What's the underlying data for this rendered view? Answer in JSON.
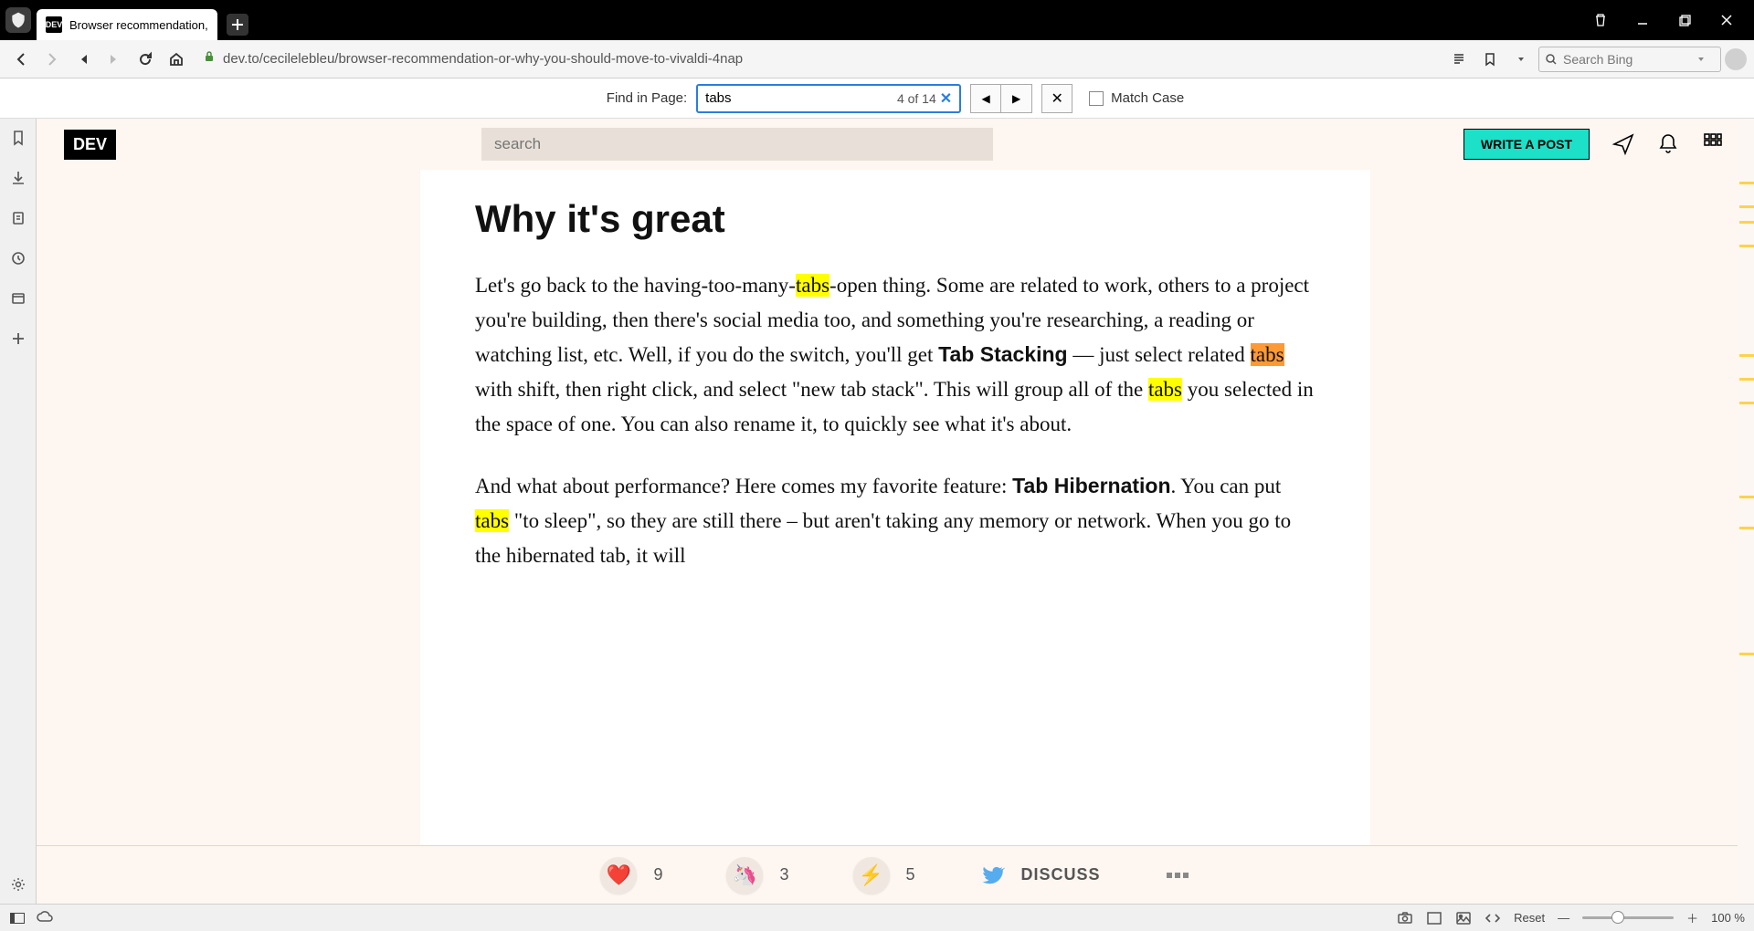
{
  "window": {
    "tab_title": "Browser recommendation,",
    "tab_favicon_text": "DEV"
  },
  "toolbar": {
    "url": "dev.to/cecilelebleu/browser-recommendation-or-why-you-should-move-to-vivaldi-4nap",
    "search_placeholder": "Search Bing"
  },
  "find": {
    "label": "Find in Page:",
    "query": "tabs",
    "count": "4 of 14",
    "match_case_label": "Match Case"
  },
  "dev_header": {
    "logo": "DEV",
    "search_placeholder": "search",
    "write_post": "WRITE A POST"
  },
  "article": {
    "heading": "Why it's great",
    "p1_a": "Let's go back to the having-too-many-",
    "p1_hl1": "tabs",
    "p1_b": "-open thing. Some are related to work, others to a project you're building, then there's social media too, and something you're researching, a reading or watching list, etc. Well, if you do the switch, you'll get ",
    "p1_bold1": "Tab Stacking",
    "p1_c": " — just select related ",
    "p1_hl2": "tabs",
    "p1_d": " with shift, then right click, and select \"new tab stack\". This will group all of the ",
    "p1_hl3": "tabs",
    "p1_e": " you selected in the space of one. You can also rename it, to quickly see what it's about.",
    "p2_a": "And what about performance? Here comes my favorite feature: ",
    "p2_bold1": "Tab Hibernation",
    "p2_b": ". You can put ",
    "p2_hl1": "tabs",
    "p2_c": " \"to sleep\", so they are still there – but aren't taking any memory or network. When you go to the hibernated tab, it will"
  },
  "engage": {
    "hearts": "9",
    "unicorns": "3",
    "bolts": "5",
    "discuss": "DISCUSS"
  },
  "status": {
    "reset": "Reset",
    "zoom": "100 %"
  }
}
